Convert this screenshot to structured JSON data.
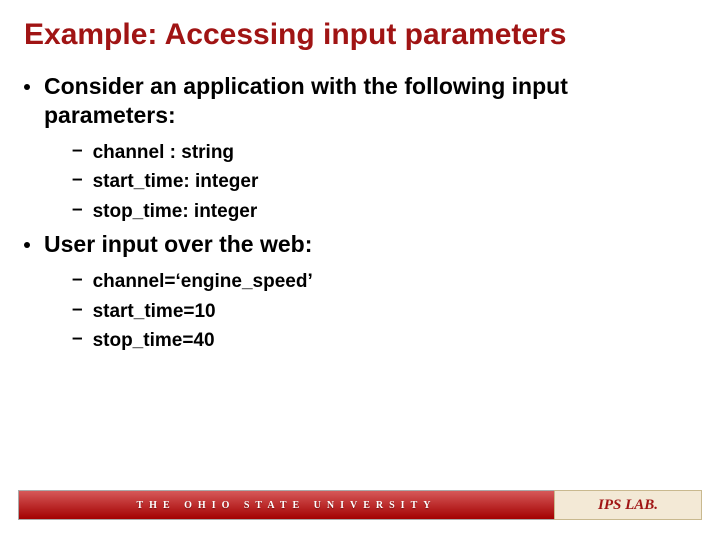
{
  "title": "Example: Accessing input parameters",
  "bullets": [
    {
      "text": "Consider an application with the following input parameters:",
      "sub": [
        "channel : string",
        "start_time: integer",
        "stop_time: integer"
      ]
    },
    {
      "text": "User input over the web:",
      "sub": [
        "channel=‘engine_speed’",
        "start_time=10",
        "stop_time=40"
      ]
    }
  ],
  "footer": {
    "university": "THE OHIO STATE UNIVERSITY",
    "lab": "IPS LAB."
  }
}
